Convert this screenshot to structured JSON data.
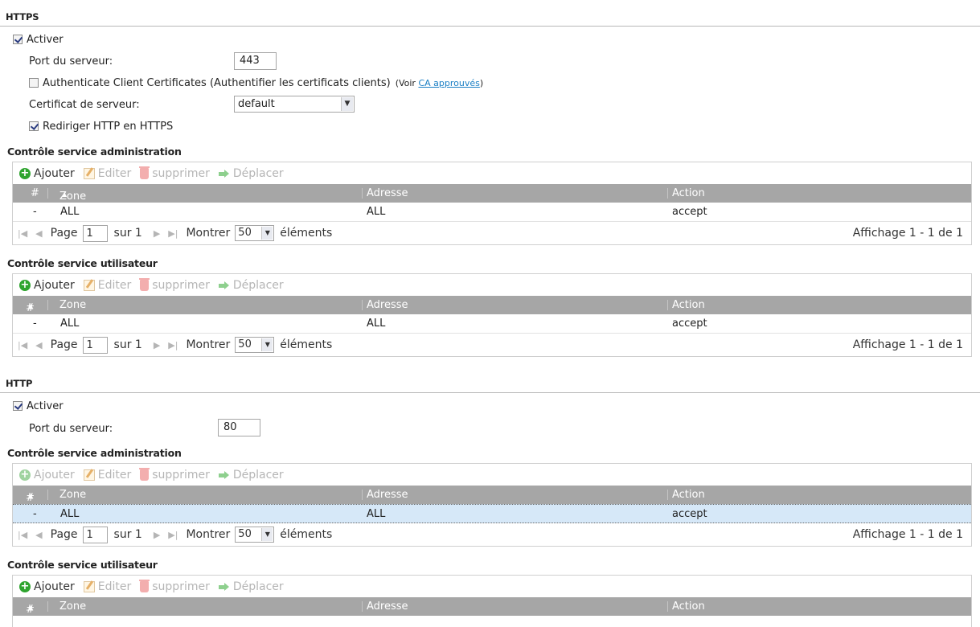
{
  "https": {
    "title": "HTTPS",
    "enable_label": "Activer",
    "port_label": "Port du serveur:",
    "port_value": "443",
    "auth_label": "Authenticate Client Certificates (Authentifier les certificats clients)",
    "auth_note_prefix": "(Voir ",
    "auth_note_link": "CA approuvés",
    "auth_note_suffix": ")",
    "cert_label": "Certificat de serveur:",
    "cert_value": "default",
    "redirect_label": "Rediriger HTTP en HTTPS"
  },
  "http": {
    "title": "HTTP",
    "enable_label": "Activer",
    "port_label": "Port du serveur:",
    "port_value": "80"
  },
  "toolbar": {
    "add": "Ajouter",
    "edit": "Editer",
    "delete": "supprimer",
    "move": "Déplacer"
  },
  "columns": {
    "num": "#",
    "zone": "Zone",
    "address": "Adresse",
    "action": "Action"
  },
  "pager": {
    "page": "Page",
    "page_value": "1",
    "of": "sur 1",
    "show": "Montrer",
    "per_page": "50",
    "items": "éléments",
    "display": "Affichage 1 - 1 de 1"
  },
  "grids": {
    "https_admin": {
      "title": "Contrôle service administration",
      "row": {
        "num": "-",
        "zone": "ALL",
        "address": "ALL",
        "action": "accept"
      }
    },
    "https_user": {
      "title": "Contrôle service utilisateur",
      "row": {
        "num": "-",
        "zone": "ALL",
        "address": "ALL",
        "action": "accept"
      }
    },
    "http_admin": {
      "title": "Contrôle service administration",
      "row": {
        "num": "-",
        "zone": "ALL",
        "address": "ALL",
        "action": "accept"
      }
    },
    "http_user": {
      "title": "Contrôle service utilisateur"
    }
  }
}
